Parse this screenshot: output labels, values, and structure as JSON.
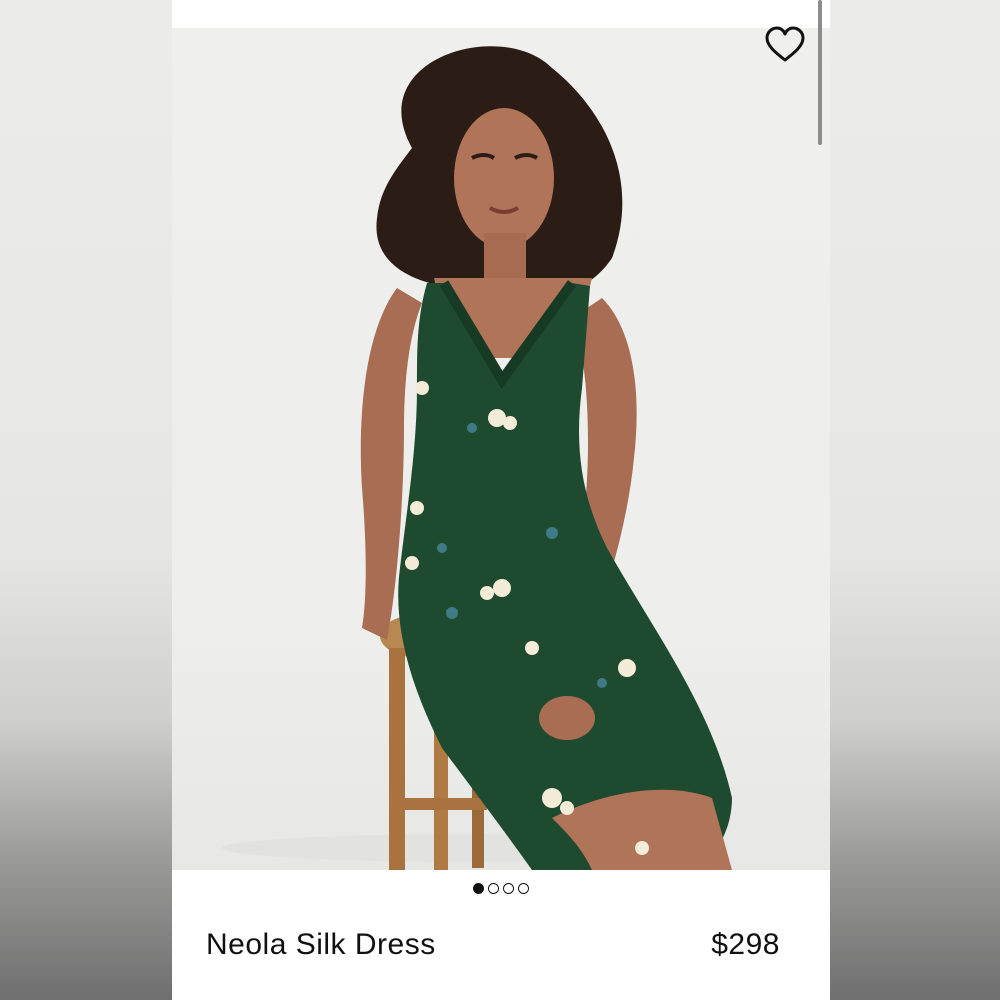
{
  "product": {
    "name": "Neola Silk Dress",
    "price": "$298"
  },
  "gallery": {
    "image_count": 4,
    "active_index": 0
  },
  "icons": {
    "favorite": "heart-outline-icon"
  },
  "colors": {
    "dress": "#1e4a2f",
    "background": "#efefed",
    "text": "#111111"
  }
}
